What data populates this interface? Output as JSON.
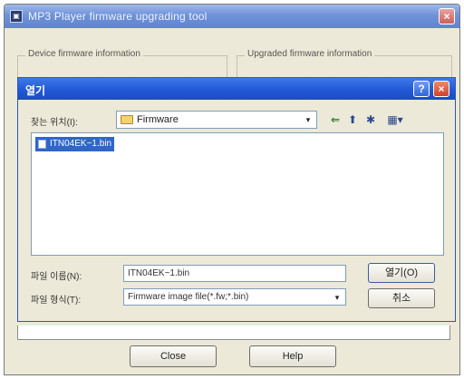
{
  "window": {
    "title": "MP3 Player firmware upgrading tool",
    "close_glyph": "×"
  },
  "groups": {
    "device_label": "Device firmware information",
    "upgraded_label": "Upgraded firmware information"
  },
  "dialog": {
    "title": "열기",
    "help_glyph": "?",
    "close_glyph": "×",
    "lookin_label": "찾는 위치(I):",
    "lookin_value": "Firmware",
    "dropdown_glyph": "▾",
    "toolbar": {
      "back_glyph": "⇐",
      "up_glyph": "⬆",
      "newfolder_glyph": "✱",
      "view_glyph": "▦▾"
    },
    "files": [
      "ITN04EK~1.bin"
    ],
    "filename_label": "파일 이름(N):",
    "filename_value": "ITN04EK~1.bin",
    "filetype_label": "파일 형식(T):",
    "filetype_value": "Firmware image file(*.fw;*.bin)",
    "open_button": "열기(O)",
    "cancel_button": "취소"
  },
  "buttons": {
    "close": "Close",
    "help": "Help"
  },
  "colors": {
    "titlebar": "#2158d6",
    "selection": "#3166c9",
    "window_bg": "#ece9d8"
  }
}
